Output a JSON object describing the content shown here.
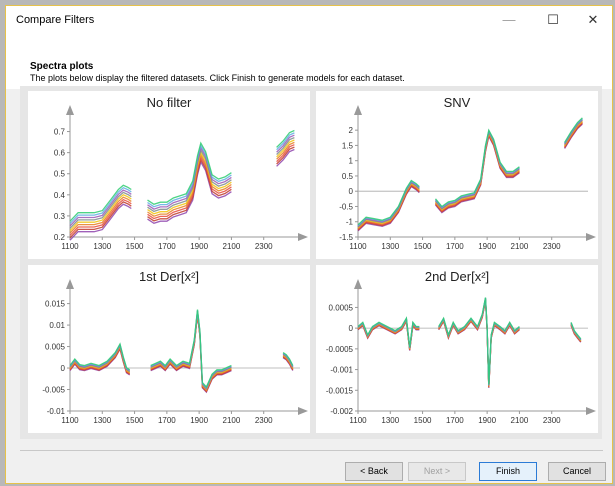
{
  "window": {
    "title": "Compare Filters",
    "controls": {
      "minimize": "—",
      "maximize": "☐",
      "close": "✕"
    }
  },
  "header": {
    "title": "Spectra plots",
    "subtitle": "The plots below display the filtered datasets. Click Finish to generate models for each dataset."
  },
  "buttons": {
    "back": "< Back",
    "next": "Next >",
    "finish": "Finish",
    "cancel": "Cancel"
  },
  "series_colors": [
    "#8e44ad",
    "#c0392b",
    "#e74c3c",
    "#e67e22",
    "#f1c40f",
    "#7f8c8d",
    "#9b59b6",
    "#5dade2",
    "#2ecc71"
  ],
  "chart_data": [
    {
      "type": "line",
      "title": "No filter",
      "xlabel": "",
      "ylabel": "",
      "x_ticks": [
        "1100",
        "1300",
        "1500",
        "1700",
        "1900",
        "2100",
        "2300"
      ],
      "y_ticks": [
        "0.7",
        "0.6",
        "0.5",
        "0.4",
        "0.3",
        "0.2"
      ],
      "xlim": [
        1100,
        2500
      ],
      "ylim": [
        0.2,
        0.75
      ],
      "segments": [
        {
          "x": [
            1100,
            1150,
            1200,
            1250,
            1300,
            1350,
            1400,
            1430,
            1460,
            1480
          ],
          "y": [
            0.23,
            0.27,
            0.27,
            0.27,
            0.28,
            0.33,
            0.38,
            0.4,
            0.39,
            0.38
          ]
        },
        {
          "x": [
            1580,
            1620,
            1660,
            1700,
            1740,
            1780,
            1820,
            1860,
            1890,
            1910,
            1940,
            1980,
            2020,
            2060,
            2100
          ],
          "y": [
            0.33,
            0.31,
            0.32,
            0.32,
            0.34,
            0.35,
            0.36,
            0.42,
            0.54,
            0.6,
            0.56,
            0.45,
            0.43,
            0.44,
            0.46
          ]
        },
        {
          "x": [
            2380,
            2420,
            2460,
            2490
          ],
          "y": [
            0.58,
            0.61,
            0.65,
            0.66
          ]
        }
      ],
      "spread": 0.045
    },
    {
      "type": "line",
      "title": "SNV",
      "xlabel": "",
      "ylabel": "",
      "x_ticks": [
        "1100",
        "1300",
        "1500",
        "1700",
        "1900",
        "2100",
        "2300"
      ],
      "y_ticks": [
        "2",
        "1.5",
        "1",
        "0.5",
        "0",
        "-0.5",
        "-1",
        "-1.5"
      ],
      "xlim": [
        1100,
        2500
      ],
      "ylim": [
        -1.5,
        2.3
      ],
      "zero_line": true,
      "segments": [
        {
          "x": [
            1100,
            1150,
            1200,
            1250,
            1300,
            1350,
            1400,
            1430,
            1460,
            1480
          ],
          "y": [
            -1.2,
            -0.95,
            -1.0,
            -1.05,
            -0.95,
            -0.6,
            0.0,
            0.25,
            0.15,
            0.05
          ]
        },
        {
          "x": [
            1580,
            1620,
            1660,
            1700,
            1740,
            1780,
            1820,
            1860,
            1890,
            1910,
            1940,
            1980,
            2020,
            2060,
            2100
          ],
          "y": [
            -0.35,
            -0.6,
            -0.45,
            -0.4,
            -0.25,
            -0.2,
            -0.15,
            0.3,
            1.4,
            1.9,
            1.6,
            0.85,
            0.55,
            0.55,
            0.7
          ]
        },
        {
          "x": [
            2380,
            2420,
            2460,
            2490
          ],
          "y": [
            1.5,
            1.85,
            2.15,
            2.3
          ]
        }
      ],
      "spread": 0.1
    },
    {
      "type": "line",
      "title": "1st Der[x²]",
      "xlabel": "",
      "ylabel": "",
      "x_ticks": [
        "1100",
        "1300",
        "1500",
        "1700",
        "1900",
        "2100",
        "2300"
      ],
      "y_ticks": [
        "0.015",
        "0.01",
        "0.005",
        "0",
        "-0.005",
        "-0.01"
      ],
      "xlim": [
        1100,
        2500
      ],
      "ylim": [
        -0.01,
        0.017
      ],
      "zero_line": true,
      "segments": [
        {
          "x": [
            1100,
            1130,
            1160,
            1190,
            1230,
            1280,
            1330,
            1380,
            1410,
            1430,
            1450,
            1470
          ],
          "y": [
            0.0,
            0.0015,
            0.0002,
            0.0,
            0.0005,
            0.0,
            0.001,
            0.003,
            0.005,
            0.002,
            -0.0005,
            -0.001
          ]
        },
        {
          "x": [
            1600,
            1630,
            1660,
            1690,
            1720,
            1760,
            1800,
            1840,
            1870,
            1890,
            1905,
            1920,
            1945,
            1980,
            2010,
            2040,
            2070,
            2100
          ],
          "y": [
            0.0,
            0.0005,
            0.001,
            0.0,
            0.0015,
            0.0,
            0.001,
            0.0005,
            0.006,
            0.013,
            0.008,
            -0.004,
            -0.005,
            -0.002,
            -0.001,
            -0.001,
            -0.0005,
            0.0
          ]
        },
        {
          "x": [
            2420,
            2440,
            2460,
            2480
          ],
          "y": [
            0.003,
            0.0025,
            0.0015,
            0.0
          ]
        }
      ],
      "spread": 0.0006
    },
    {
      "type": "line",
      "title": "2nd Der[x²]",
      "xlabel": "",
      "ylabel": "",
      "x_ticks": [
        "1100",
        "1300",
        "1500",
        "1700",
        "1900",
        "2100",
        "2300"
      ],
      "y_ticks": [
        "0.0005",
        "0",
        "-0.0005",
        "-0.001",
        "-0.0015",
        "-0.002"
      ],
      "xlim": [
        1100,
        2500
      ],
      "ylim": [
        -0.002,
        0.0008
      ],
      "zero_line": true,
      "segments": [
        {
          "x": [
            1100,
            1130,
            1160,
            1190,
            1230,
            1280,
            1330,
            1370,
            1400,
            1420,
            1440,
            1460,
            1480
          ],
          "y": [
            0.0,
            0.0001,
            -0.0002,
            0.0,
            0.0001,
            0.0,
            -0.0001,
            0.0,
            0.0002,
            -0.0005,
            0.0001,
            0.0,
            0.0
          ]
        },
        {
          "x": [
            1600,
            1630,
            1660,
            1690,
            1720,
            1760,
            1800,
            1840,
            1870,
            1890,
            1900,
            1910,
            1925,
            1945,
            1980,
            2010,
            2040,
            2070,
            2100
          ],
          "y": [
            0.0,
            0.0002,
            -0.0002,
            0.0001,
            -0.0001,
            0.0,
            0.0002,
            0.0,
            0.0003,
            0.0007,
            0.0,
            -0.0014,
            -0.0002,
            0.0001,
            0.0,
            -0.0001,
            0.0001,
            -0.0001,
            0.0
          ]
        },
        {
          "x": [
            2420,
            2440,
            2460,
            2480
          ],
          "y": [
            0.0001,
            -0.0001,
            -0.0002,
            -0.0003
          ]
        }
      ],
      "spread": 4e-05
    }
  ]
}
